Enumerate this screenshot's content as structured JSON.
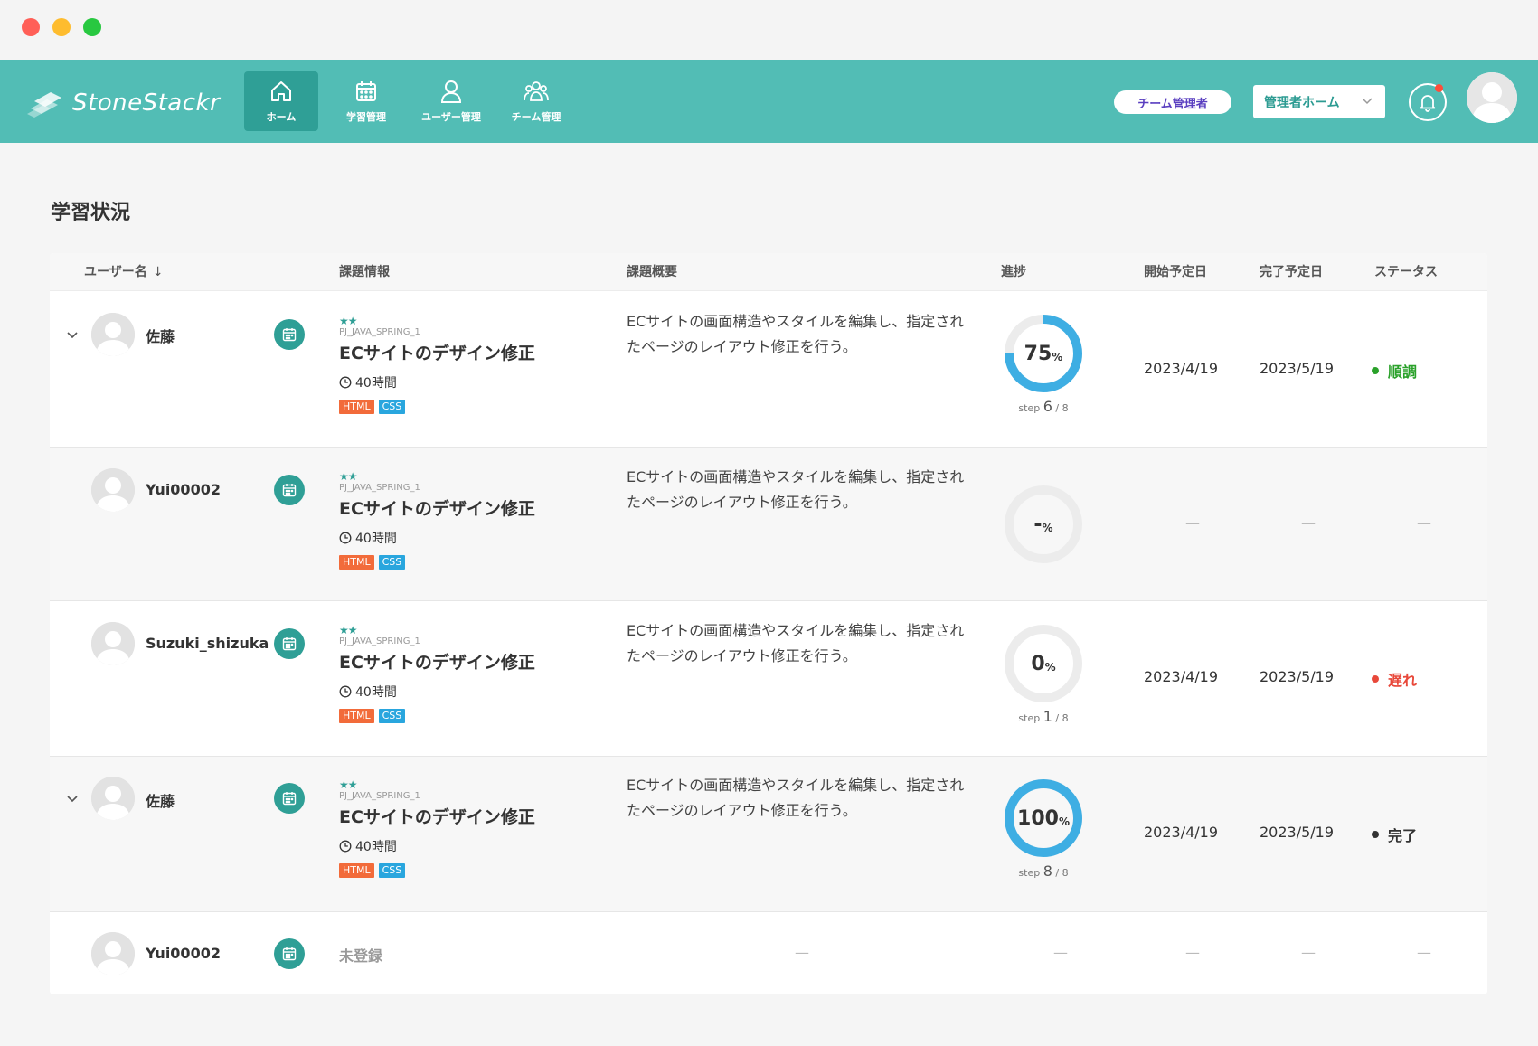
{
  "app": {
    "name": "StoneStackr"
  },
  "nav": [
    {
      "label": "ホーム",
      "icon": "home-icon",
      "active": true
    },
    {
      "label": "学習管理",
      "icon": "calendar-icon",
      "active": false
    },
    {
      "label": "ユーザー管理",
      "icon": "user-icon",
      "active": false
    },
    {
      "label": "チーム管理",
      "icon": "team-icon",
      "active": false
    }
  ],
  "header": {
    "role_badge": "チーム管理者",
    "admin_select": "管理者ホーム",
    "has_notification": true
  },
  "page": {
    "title": "学習状況"
  },
  "table": {
    "columns": {
      "user": "ユーザー名",
      "task_info": "課題情報",
      "task_summary": "課題概要",
      "progress": "進捗",
      "start": "開始予定日",
      "end": "完了予定日",
      "status": "ステータス"
    },
    "rows": [
      {
        "expandable": true,
        "user": "佐藤",
        "stars": "★★",
        "code": "PJ_JAVA_SPRING_1",
        "title": "ECサイトのデザイン修正",
        "hours": "40時間",
        "tags": [
          "HTML",
          "CSS"
        ],
        "summary": "ECサイトの画面構造やスタイルを編集し、指定されたページのレイアウト修正を行う。",
        "progress_num": "75",
        "progress_unit": "%",
        "progress_fraction": 0.75,
        "step_label": "step",
        "step_current": "6",
        "step_total": "/ 8",
        "start": "2023/4/19",
        "end": "2023/5/19",
        "status": "順調",
        "status_color": "#2aa12a"
      },
      {
        "expandable": false,
        "user": "Yui00002",
        "stars": "★★",
        "code": "PJ_JAVA_SPRING_1",
        "title": "ECサイトのデザイン修正",
        "hours": "40時間",
        "tags": [
          "HTML",
          "CSS"
        ],
        "summary": "ECサイトの画面構造やスタイルを編集し、指定されたページのレイアウト修正を行う。",
        "progress_num": "-",
        "progress_unit": "%",
        "progress_fraction": 0,
        "dash": "—"
      },
      {
        "expandable": false,
        "user": "Suzuki_shizuka",
        "stars": "★★",
        "code": "PJ_JAVA_SPRING_1",
        "title": "ECサイトのデザイン修正",
        "hours": "40時間",
        "tags": [
          "HTML",
          "CSS"
        ],
        "summary": "ECサイトの画面構造やスタイルを編集し、指定されたページのレイアウト修正を行う。",
        "progress_num": "0",
        "progress_unit": "%",
        "progress_fraction": 0,
        "step_label": "step",
        "step_current": "1",
        "step_total": "/ 8",
        "start": "2023/4/19",
        "end": "2023/5/19",
        "status": "遅れ",
        "status_color": "#e8483a"
      },
      {
        "expandable": true,
        "user": "佐藤",
        "stars": "★★",
        "code": "PJ_JAVA_SPRING_1",
        "title": "ECサイトのデザイン修正",
        "hours": "40時間",
        "tags": [
          "HTML",
          "CSS"
        ],
        "summary": "ECサイトの画面構造やスタイルを編集し、指定されたページのレイアウト修正を行う。",
        "progress_num": "100",
        "progress_unit": "%",
        "progress_fraction": 1.0,
        "step_label": "step",
        "step_current": "8",
        "step_total": "/ 8",
        "start": "2023/4/19",
        "end": "2023/5/19",
        "status": "完了",
        "status_color": "#333333"
      },
      {
        "expandable": false,
        "user": "Yui00002",
        "unregistered": "未登録",
        "dash": "—"
      }
    ]
  },
  "colors": {
    "header": "#52bdb5",
    "accent": "#2f9f96",
    "tag_html": "#f26b3a",
    "tag_css": "#29a6de",
    "donut": "#3eaee3",
    "donut_track": "#ececec"
  }
}
